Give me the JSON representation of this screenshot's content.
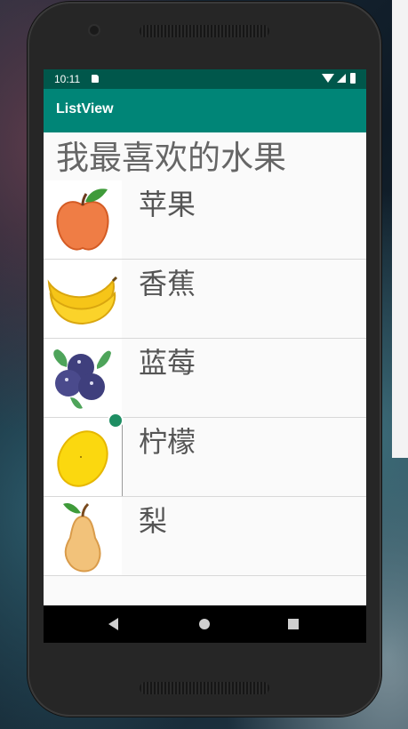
{
  "status": {
    "time": "10:11"
  },
  "app": {
    "title": "ListView"
  },
  "heading": "我最喜欢的水果",
  "fruits": [
    {
      "name": "苹果",
      "icon": "apple-icon"
    },
    {
      "name": "香蕉",
      "icon": "banana-icon"
    },
    {
      "name": "蓝莓",
      "icon": "blueberry-icon"
    },
    {
      "name": "柠檬",
      "icon": "lemon-icon"
    },
    {
      "name": "梨",
      "icon": "pear-icon"
    }
  ],
  "colors": {
    "status_bar": "#00574b",
    "app_bar": "#008577",
    "list_text": "#555555"
  }
}
